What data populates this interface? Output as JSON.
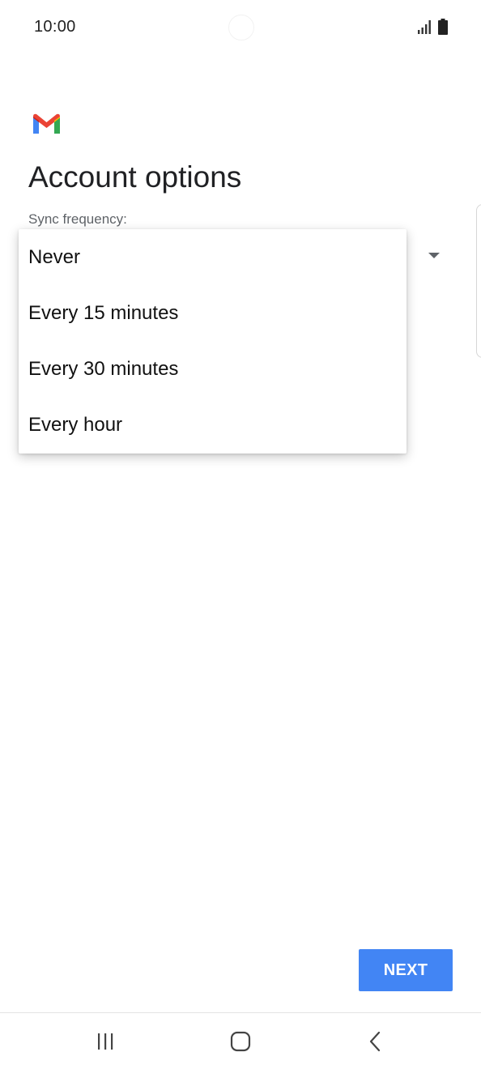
{
  "status_bar": {
    "time": "10:00"
  },
  "app": {
    "logo_icon": "gmail-logo-icon"
  },
  "page": {
    "title": "Account options",
    "sync_label": "Sync frequency:"
  },
  "dropdown": {
    "options": [
      {
        "label": "Never"
      },
      {
        "label": "Every 15 minutes"
      },
      {
        "label": "Every 30 minutes"
      },
      {
        "label": "Every hour"
      }
    ]
  },
  "actions": {
    "next_label": "NEXT",
    "accent_color": "#4285f4"
  },
  "nav_bar": {
    "icons": [
      "recent-apps-icon",
      "home-icon",
      "back-icon"
    ]
  }
}
